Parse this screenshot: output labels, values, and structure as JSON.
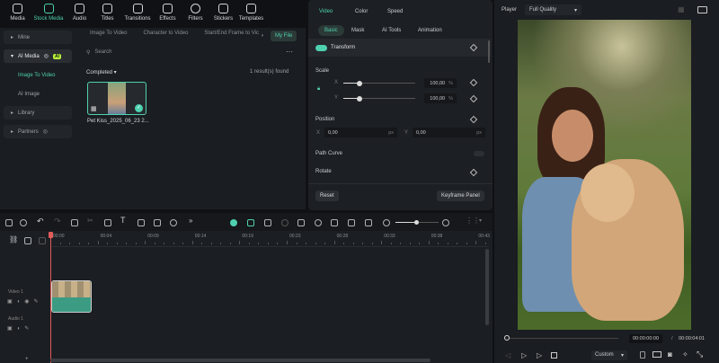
{
  "toolbar": {
    "items": [
      {
        "label": "Media"
      },
      {
        "label": "Stock Media",
        "active": true
      },
      {
        "label": "Audio"
      },
      {
        "label": "Titles"
      },
      {
        "label": "Transitions"
      },
      {
        "label": "Effects"
      },
      {
        "label": "Filters"
      },
      {
        "label": "Stickers"
      },
      {
        "label": "Templates"
      }
    ]
  },
  "sidebar": {
    "mine": "Mine",
    "ai_media": "AI Media",
    "ai_badge": "AI",
    "image_to_video": "Image To Video",
    "ai_image": "AI Image",
    "library": "Library",
    "partners": "Partners"
  },
  "media": {
    "tabs": [
      "Image To Video",
      "Character to Video",
      "Start/End Frame to Vic",
      "My File"
    ],
    "search_placeholder": "Search",
    "filter": "Completed",
    "results": "1 result(s) found",
    "clip_name": "Pet Kiss_2025_06_23 2..."
  },
  "properties": {
    "tabs": [
      "Video",
      "Color",
      "Speed"
    ],
    "subtabs": [
      "Basic",
      "Mask",
      "AI Tools",
      "Animation"
    ],
    "transform": "Transform",
    "scale": "Scale",
    "x": "X",
    "y": "Y",
    "scale_x": "100,00",
    "scale_y": "100,00",
    "percent": "%",
    "scale_value_fraction": 0.23,
    "position": "Position",
    "pos_x": "0,00",
    "pos_y": "0,00",
    "px": "px",
    "path_curve": "Path Curve",
    "rotate": "Rotate",
    "reset": "Reset",
    "keyframe_panel": "Keyframe Panel"
  },
  "timeline": {
    "ruler": [
      "00:00",
      "00:04",
      "00:09",
      "00:14",
      "00:19",
      "00:23",
      "00:28",
      "00:33",
      "00:38",
      "00:43"
    ],
    "video_track": "Video 1",
    "audio_track": "Audio 1"
  },
  "player": {
    "label": "Player",
    "quality": "Full Quality",
    "current_time": "00:00:00:00",
    "separator": "/",
    "total_time": "00:00:04:01",
    "ratio": "Custom",
    "accent": "#4fd1b0"
  }
}
